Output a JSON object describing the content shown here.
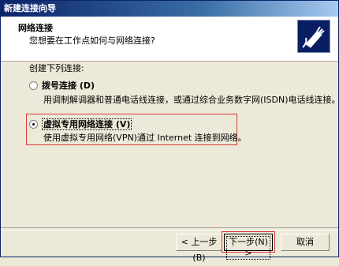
{
  "window": {
    "title": "新建连接向导"
  },
  "header": {
    "title": "网络连接",
    "subtitle": "您想要在工作点如何与网络连接?",
    "icon": "network-connection-icon"
  },
  "content": {
    "create_label": "创建下列连接:",
    "options": [
      {
        "label": "拨号连接 (D)",
        "description": "用调制解调器和普通电话线连接，或通过综合业务数字网(ISDN)电话线连接。",
        "selected": false
      },
      {
        "label": "虚拟专用网络连接 (V)",
        "description": "使用虚拟专用网络(VPN)通过 Internet 连接到网络。",
        "selected": true
      }
    ]
  },
  "buttons": {
    "back": "< 上一步(B)",
    "next": "下一步(N) >",
    "cancel": "取消"
  }
}
